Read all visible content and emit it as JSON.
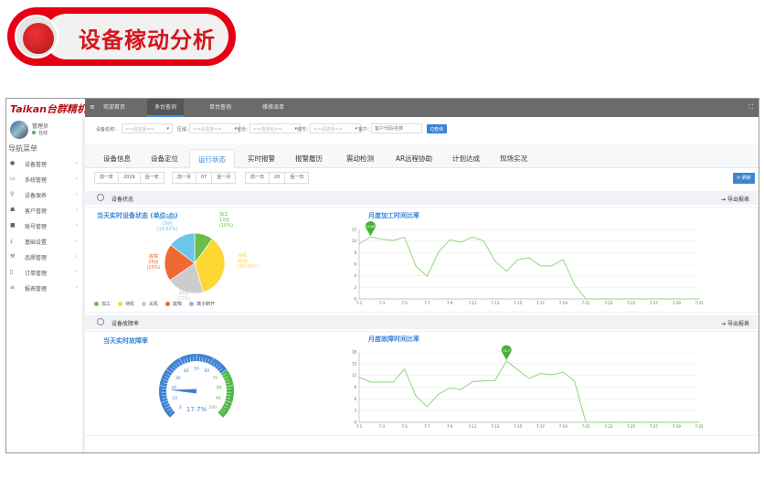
{
  "banner": {
    "title": "设备稼动分析"
  },
  "app": {
    "logo": "Taikan台群精机",
    "fullscreen_icon": "expand-icon"
  },
  "topnav": [
    {
      "label": "欢迎首页"
    },
    {
      "label": "多台查询",
      "active": true
    },
    {
      "label": "单台查询"
    },
    {
      "label": "维修派单"
    }
  ],
  "user": {
    "name": "管理员",
    "status": "在线"
  },
  "sidebar": {
    "title": "导航菜单",
    "items": [
      {
        "label": "设备管理",
        "icon": "gear-icon"
      },
      {
        "label": "系统管理",
        "icon": "monitor-icon"
      },
      {
        "label": "设备保养",
        "icon": "motorcycle-icon"
      },
      {
        "label": "客户管理",
        "icon": "users-icon"
      },
      {
        "label": "账号管理",
        "icon": "briefcase-icon"
      },
      {
        "label": "基础设置",
        "icon": "download-icon"
      },
      {
        "label": "品质管理",
        "icon": "wrench-icon"
      },
      {
        "label": "订单管理",
        "icon": "file-icon"
      },
      {
        "label": "报表管理",
        "icon": "list-icon"
      }
    ]
  },
  "filters": {
    "device_label": "设备名称：",
    "device_value": "==请选择==",
    "region_label": "区域：",
    "region_value": "==请选择==",
    "province_label": "省份：",
    "province_value": "==选择省==",
    "city_label": "城市：",
    "city_value": "==请选择==",
    "customer_label": "客户：",
    "customer_placeholder": "客户代码/名称",
    "search_button": "Q查询"
  },
  "tabs": [
    {
      "label": "设备信息"
    },
    {
      "label": "设备定位"
    },
    {
      "label": "运行状态",
      "active": true
    },
    {
      "label": "实时报警"
    },
    {
      "label": "报警履历"
    },
    {
      "label": "震动检测"
    },
    {
      "label": "AR远程协助"
    },
    {
      "label": "计划达成"
    },
    {
      "label": "现场实况"
    }
  ],
  "dates": {
    "prev_year": "前一年",
    "year": "2019",
    "next_year": "后一年",
    "prev_month": "前一月",
    "month": "07",
    "next_month": "后一月",
    "prev_day": "前一日",
    "day": "20",
    "next_day": "后一日",
    "refresh": "刷新"
  },
  "section1": {
    "title": "设备状态",
    "export": "导出报表"
  },
  "section2": {
    "title": "设备故障率",
    "export": "导出报表"
  },
  "colors": {
    "accent": "#3a85d6",
    "green": "#6abf4b",
    "yellow": "#fdd835",
    "gray": "#cccccc",
    "orange": "#ef6a32",
    "blue": "#6cc6e8",
    "line": "#8fd67a"
  },
  "chart_data": [
    {
      "type": "pie",
      "title": "当天实时设备状态 (单位:台)",
      "legend": "bottom",
      "slices": [
        {
          "name": "加工",
          "count": "13台",
          "pct": "(10%)",
          "value": 10,
          "color": "#6abf4b"
        },
        {
          "name": "待机",
          "count": "46台",
          "pct": "(35.38%)",
          "value": 35.38,
          "color": "#fdd835"
        },
        {
          "name": "关机",
          "count": "26台",
          "pct": "(20%)",
          "value": 20,
          "color": "#cccccc"
        },
        {
          "name": "故障",
          "count": "26台",
          "pct": "(20%)",
          "value": 20,
          "color": "#ef6a32"
        },
        {
          "name": "离子断开",
          "count": "19台",
          "pct": "(14.62%)",
          "value": 14.62,
          "color": "#6cc6e8"
        }
      ]
    },
    {
      "type": "line",
      "title": "月度加工时间比率",
      "ylim": [
        0,
        12
      ],
      "yticks": [
        0,
        2,
        4,
        6,
        8,
        10,
        12
      ],
      "grid": true,
      "x": [
        "7-1",
        "7-2",
        "7-3",
        "7-4",
        "7-5",
        "7-6",
        "7-7",
        "7-8",
        "7-9",
        "7-10",
        "7-11",
        "7-12",
        "7-13",
        "7-14",
        "7-15",
        "7-16",
        "7-17",
        "7-18",
        "7-19",
        "7-20",
        "7-21",
        "7-22",
        "7-23",
        "7-24",
        "7-25",
        "7-26",
        "7-27",
        "7-28",
        "7-29",
        "7-30",
        "7-31"
      ],
      "values": [
        9.5,
        10.7,
        10.3,
        10.1,
        10.66,
        5.7,
        3.9,
        8.1,
        10.2,
        9.8,
        10.7,
        10.0,
        6.5,
        4.8,
        6.8,
        7.1,
        5.7,
        5.7,
        6.8,
        2.5,
        0,
        0,
        0,
        0,
        0,
        0,
        0,
        0,
        0,
        0,
        0
      ],
      "max_marker": "10.66"
    },
    {
      "type": "gauge",
      "title": "当天实时故障率",
      "min": 0,
      "max": 100,
      "ticks": [
        0,
        10,
        20,
        30,
        40,
        50,
        60,
        70,
        80,
        90,
        100
      ],
      "value": 17.7,
      "label": "17.7%"
    },
    {
      "type": "line",
      "title": "月度故障时间比率",
      "ylim": [
        0,
        18
      ],
      "yticks": [
        0,
        3,
        6,
        9,
        12,
        15,
        18
      ],
      "grid": true,
      "x": [
        "7-1",
        "7-2",
        "7-3",
        "7-4",
        "7-5",
        "7-6",
        "7-7",
        "7-8",
        "7-9",
        "7-10",
        "7-11",
        "7-12",
        "7-13",
        "7-14",
        "7-15",
        "7-16",
        "7-17",
        "7-18",
        "7-19",
        "7-20",
        "7-21",
        "7-22",
        "7-23",
        "7-24",
        "7-25",
        "7-26",
        "7-27",
        "7-28",
        "7-29",
        "7-30",
        "7-31"
      ],
      "values": [
        11.5,
        10.3,
        10.3,
        10.3,
        13.6,
        6.8,
        4.0,
        7.2,
        8.8,
        8.4,
        10.4,
        10.6,
        10.7,
        15.7,
        13.4,
        11.2,
        12.5,
        12.2,
        12.8,
        10.6,
        0,
        0,
        0,
        0,
        0,
        0,
        0,
        0,
        0,
        0,
        0
      ],
      "max_marker": "15.7"
    }
  ]
}
